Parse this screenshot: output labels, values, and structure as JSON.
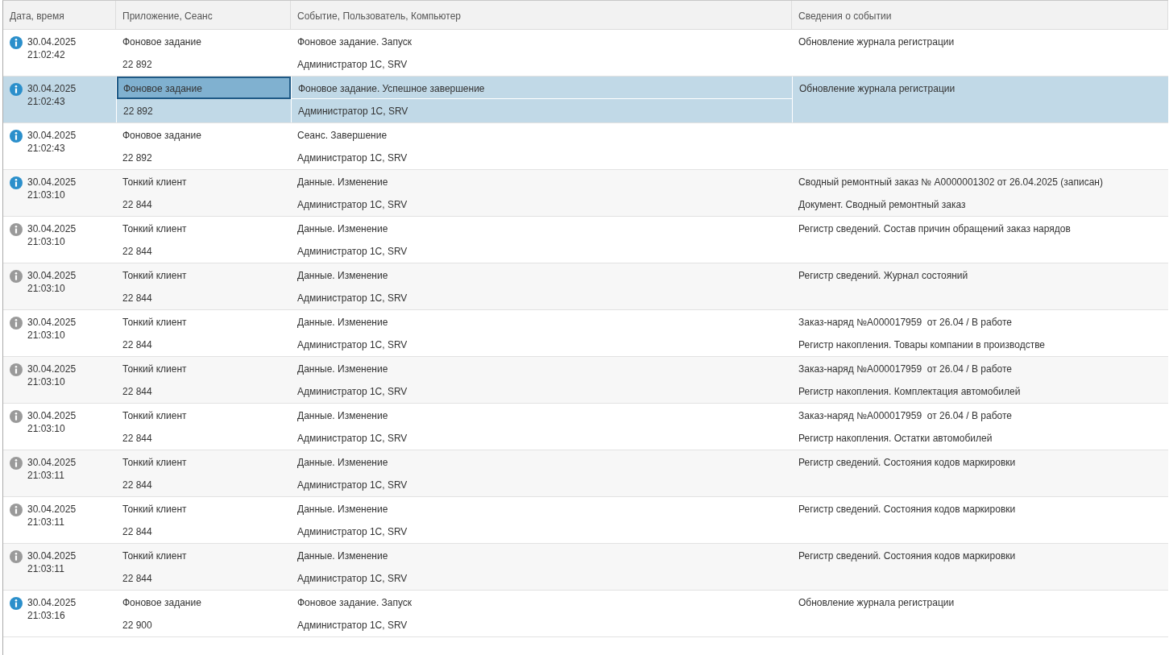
{
  "table": {
    "columns": [
      "Дата, время",
      "Приложение, Сеанс",
      "Событие, Пользователь, Компьютер",
      "Сведения о событии"
    ],
    "rows": [
      {
        "kind": "info",
        "date": "30.04.2025",
        "time": "21:02:42",
        "app": "Фоновое задание",
        "session": "22 892",
        "event": "Фоновое задание. Запуск",
        "user": "Администратор 1С, SRV",
        "details": [
          "Обновление журнала регистрации"
        ],
        "selected": false,
        "focused": false
      },
      {
        "kind": "info",
        "date": "30.04.2025",
        "time": "21:02:43",
        "app": "Фоновое задание",
        "session": "22 892",
        "event": "Фоновое задание. Успешное завершение",
        "user": "Администратор 1С, SRV",
        "details": [
          "Обновление журнала регистрации"
        ],
        "selected": true,
        "focused": true
      },
      {
        "kind": "info",
        "date": "30.04.2025",
        "time": "21:02:43",
        "app": "Фоновое задание",
        "session": "22 892",
        "event": "Сеанс. Завершение",
        "user": "Администратор 1С, SRV",
        "details": [],
        "selected": false,
        "focused": false
      },
      {
        "kind": "info",
        "date": "30.04.2025",
        "time": "21:03:10",
        "app": "Тонкий клиент",
        "session": "22 844",
        "event": "Данные. Изменение",
        "user": "Администратор 1С, SRV",
        "details": [
          "Сводный ремонтный заказ № А0000001302 от 26.04.2025 (записан)",
          "Документ. Сводный ремонтный заказ"
        ],
        "selected": false,
        "focused": false
      },
      {
        "kind": "note",
        "date": "30.04.2025",
        "time": "21:03:10",
        "app": "Тонкий клиент",
        "session": "22 844",
        "event": "Данные. Изменение",
        "user": "Администратор 1С, SRV",
        "details": [
          "Регистр сведений. Состав причин обращений заказ нарядов"
        ],
        "selected": false,
        "focused": false
      },
      {
        "kind": "note",
        "date": "30.04.2025",
        "time": "21:03:10",
        "app": "Тонкий клиент",
        "session": "22 844",
        "event": "Данные. Изменение",
        "user": "Администратор 1С, SRV",
        "details": [
          "Регистр сведений. Журнал состояний"
        ],
        "selected": false,
        "focused": false
      },
      {
        "kind": "note",
        "date": "30.04.2025",
        "time": "21:03:10",
        "app": "Тонкий клиент",
        "session": "22 844",
        "event": "Данные. Изменение",
        "user": "Администратор 1С, SRV",
        "details": [
          "Заказ-наряд №А000017959  от 26.04 / В работе",
          "Регистр накопления. Товары компании в производстве"
        ],
        "selected": false,
        "focused": false
      },
      {
        "kind": "note",
        "date": "30.04.2025",
        "time": "21:03:10",
        "app": "Тонкий клиент",
        "session": "22 844",
        "event": "Данные. Изменение",
        "user": "Администратор 1С, SRV",
        "details": [
          "Заказ-наряд №А000017959  от 26.04 / В работе",
          "Регистр накопления. Комплектация автомобилей"
        ],
        "selected": false,
        "focused": false
      },
      {
        "kind": "note",
        "date": "30.04.2025",
        "time": "21:03:10",
        "app": "Тонкий клиент",
        "session": "22 844",
        "event": "Данные. Изменение",
        "user": "Администратор 1С, SRV",
        "details": [
          "Заказ-наряд №А000017959  от 26.04 / В работе",
          "Регистр накопления. Остатки автомобилей"
        ],
        "selected": false,
        "focused": false
      },
      {
        "kind": "note",
        "date": "30.04.2025",
        "time": "21:03:11",
        "app": "Тонкий клиент",
        "session": "22 844",
        "event": "Данные. Изменение",
        "user": "Администратор 1С, SRV",
        "details": [
          "Регистр сведений. Состояния кодов маркировки"
        ],
        "selected": false,
        "focused": false
      },
      {
        "kind": "note",
        "date": "30.04.2025",
        "time": "21:03:11",
        "app": "Тонкий клиент",
        "session": "22 844",
        "event": "Данные. Изменение",
        "user": "Администратор 1С, SRV",
        "details": [
          "Регистр сведений. Состояния кодов маркировки"
        ],
        "selected": false,
        "focused": false
      },
      {
        "kind": "note",
        "date": "30.04.2025",
        "time": "21:03:11",
        "app": "Тонкий клиент",
        "session": "22 844",
        "event": "Данные. Изменение",
        "user": "Администратор 1С, SRV",
        "details": [
          "Регистр сведений. Состояния кодов маркировки"
        ],
        "selected": false,
        "focused": false
      },
      {
        "kind": "info",
        "date": "30.04.2025",
        "time": "21:03:16",
        "app": "Фоновое задание",
        "session": "22 900",
        "event": "Фоновое задание. Запуск",
        "user": "Администратор 1С, SRV",
        "details": [
          "Обновление журнала регистрации"
        ],
        "selected": false,
        "focused": false
      }
    ]
  }
}
